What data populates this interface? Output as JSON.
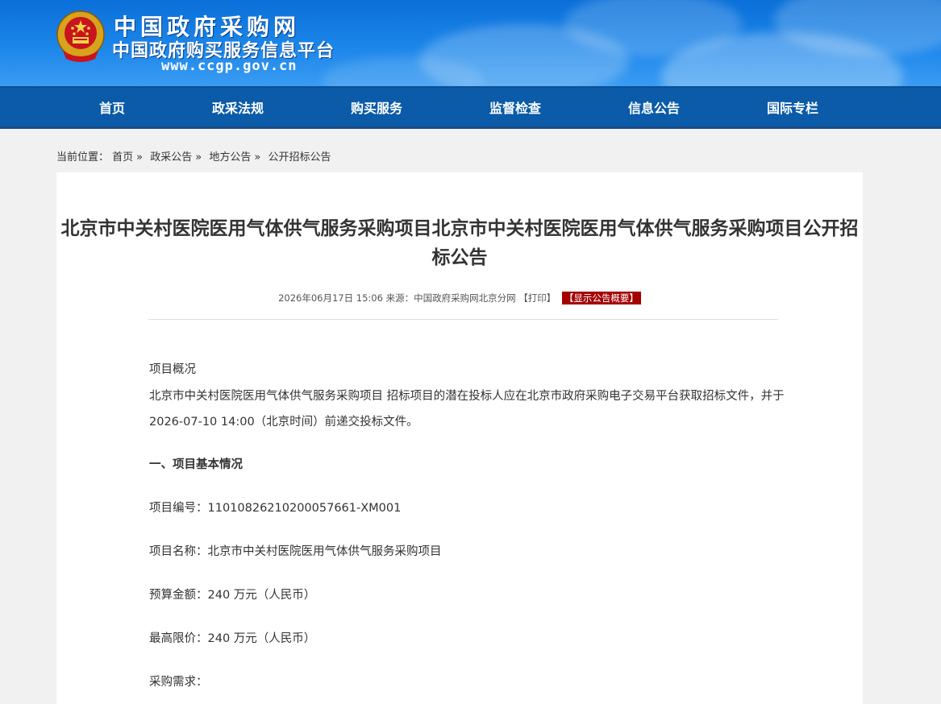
{
  "header": {
    "site_name": "中国政府采购网",
    "site_subtitle": "中国政府购买服务信息平台",
    "site_url": "www.ccgp.gov.cn"
  },
  "nav": {
    "items": [
      "首页",
      "政采法规",
      "购买服务",
      "监督检查",
      "信息公告",
      "国际专栏"
    ]
  },
  "breadcrumb": {
    "prefix": "当前位置：",
    "items": [
      "首页",
      "政采公告",
      "地方公告",
      "公开招标公告"
    ],
    "separator": "»"
  },
  "article": {
    "title": "北京市中关村医院医用气体供气服务采购项目北京市中关村医院医用气体供气服务采购项目公开招标公告",
    "date": "2026年06月17日 15:06",
    "source_label": "来源：",
    "source": "中国政府采购网北京分网",
    "print_label": "【打印】",
    "summary_label": "【显示公告概要】",
    "overview_heading": "项目概况",
    "overview_text": "北京市中关村医院医用气体供气服务采购项目 招标项目的潜在投标人应在北京市政府采购电子交易平台获取招标文件，并于2026-07-10 14:00（北京时间）前递交投标文件。",
    "section_1": "一、项目基本情况",
    "fields": [
      {
        "label": "项目编号：",
        "value": "11010826210200057661-XM001"
      },
      {
        "label": "项目名称：",
        "value": "北京市中关村医院医用气体供气服务采购项目"
      },
      {
        "label": "预算金额：",
        "value": "240 万元（人民币）"
      },
      {
        "label": "最高限价：",
        "value": "240 万元（人民币）"
      },
      {
        "label": "采购需求：",
        "value": ""
      }
    ]
  },
  "colors": {
    "banner_blue": "#1c86ea",
    "nav_blue": "#0b5ba8",
    "summary_red": "#a40000",
    "page_bg": "#f1f1f1"
  }
}
